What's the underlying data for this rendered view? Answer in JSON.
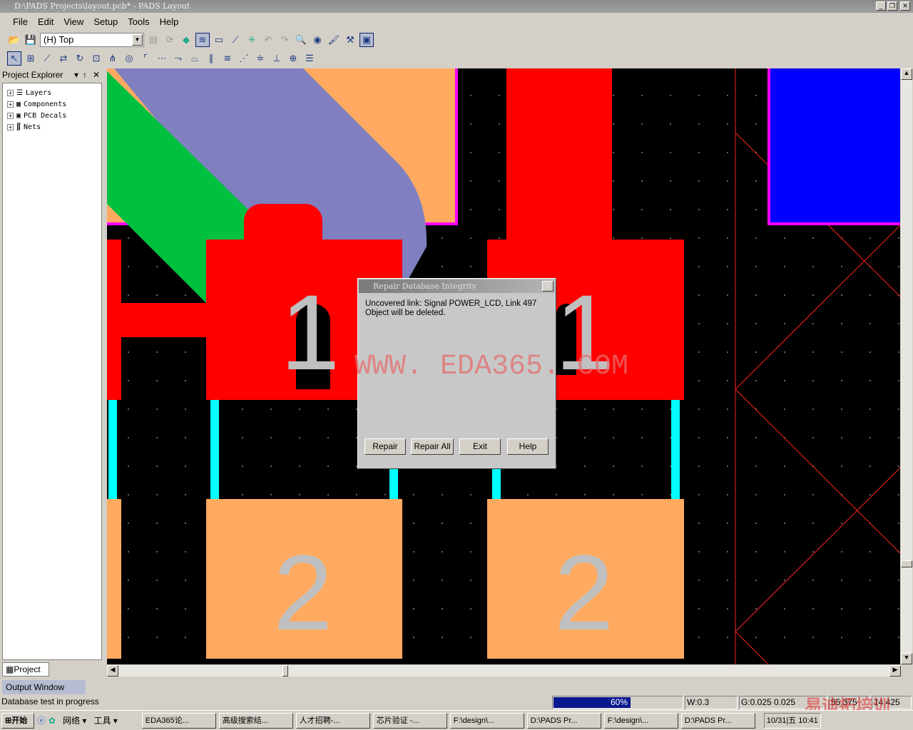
{
  "window": {
    "title": "D:\\PADS Projects\\layout.pcb* - PADS Layout"
  },
  "menu": [
    "File",
    "Edit",
    "View",
    "Setup",
    "Tools",
    "Help"
  ],
  "toolbar": {
    "layer_select": "(H) Top"
  },
  "project_explorer": {
    "title": "Project Explorer",
    "pin": "↑",
    "close": "✕",
    "items": [
      "Layers",
      "Components",
      "PCB Decals",
      "Nets"
    ],
    "tab": "Project"
  },
  "pcb": {
    "pad_label_1": "1",
    "pad_label_2": "2",
    "colors": {
      "top": "#ff0000",
      "pad": "#ffaa60",
      "trace": "#00ffff",
      "purple": "#8080c0",
      "green": "#00c040",
      "blue": "#0000ff",
      "outline": "#ff00ff"
    }
  },
  "dialog": {
    "title": "Repair Database Integrity",
    "close": "✕",
    "line1": "Uncovered link: Signal POWER_LCD, Link 497",
    "line2": "Object will be deleted.",
    "buttons": [
      "Repair",
      "Repair All",
      "Exit",
      "Help"
    ]
  },
  "watermark": "WWW. EDA365. COM",
  "output_window": {
    "tab": "Output Window"
  },
  "status": {
    "message": "Database test in progress",
    "progress_percent": 60,
    "progress_label": "60%",
    "width": "W:0.3",
    "grid": "G:0.025 0.025",
    "x": "55.375",
    "y": "14.425"
  },
  "taskbar": {
    "start": "开始",
    "quick": [
      "网络 ▾",
      "工具 ▾"
    ],
    "tasks": [
      "EDA365论...",
      "高级搜索结...",
      "人才招聘-...",
      "芯片验证 -...",
      "F:\\design\\...",
      "D:\\PADS Pr...",
      "F:\\design\\...",
      "D:\\PADS Pr..."
    ],
    "clock": "10/31|五 10:41",
    "logo_text": "易迪拓培训"
  }
}
